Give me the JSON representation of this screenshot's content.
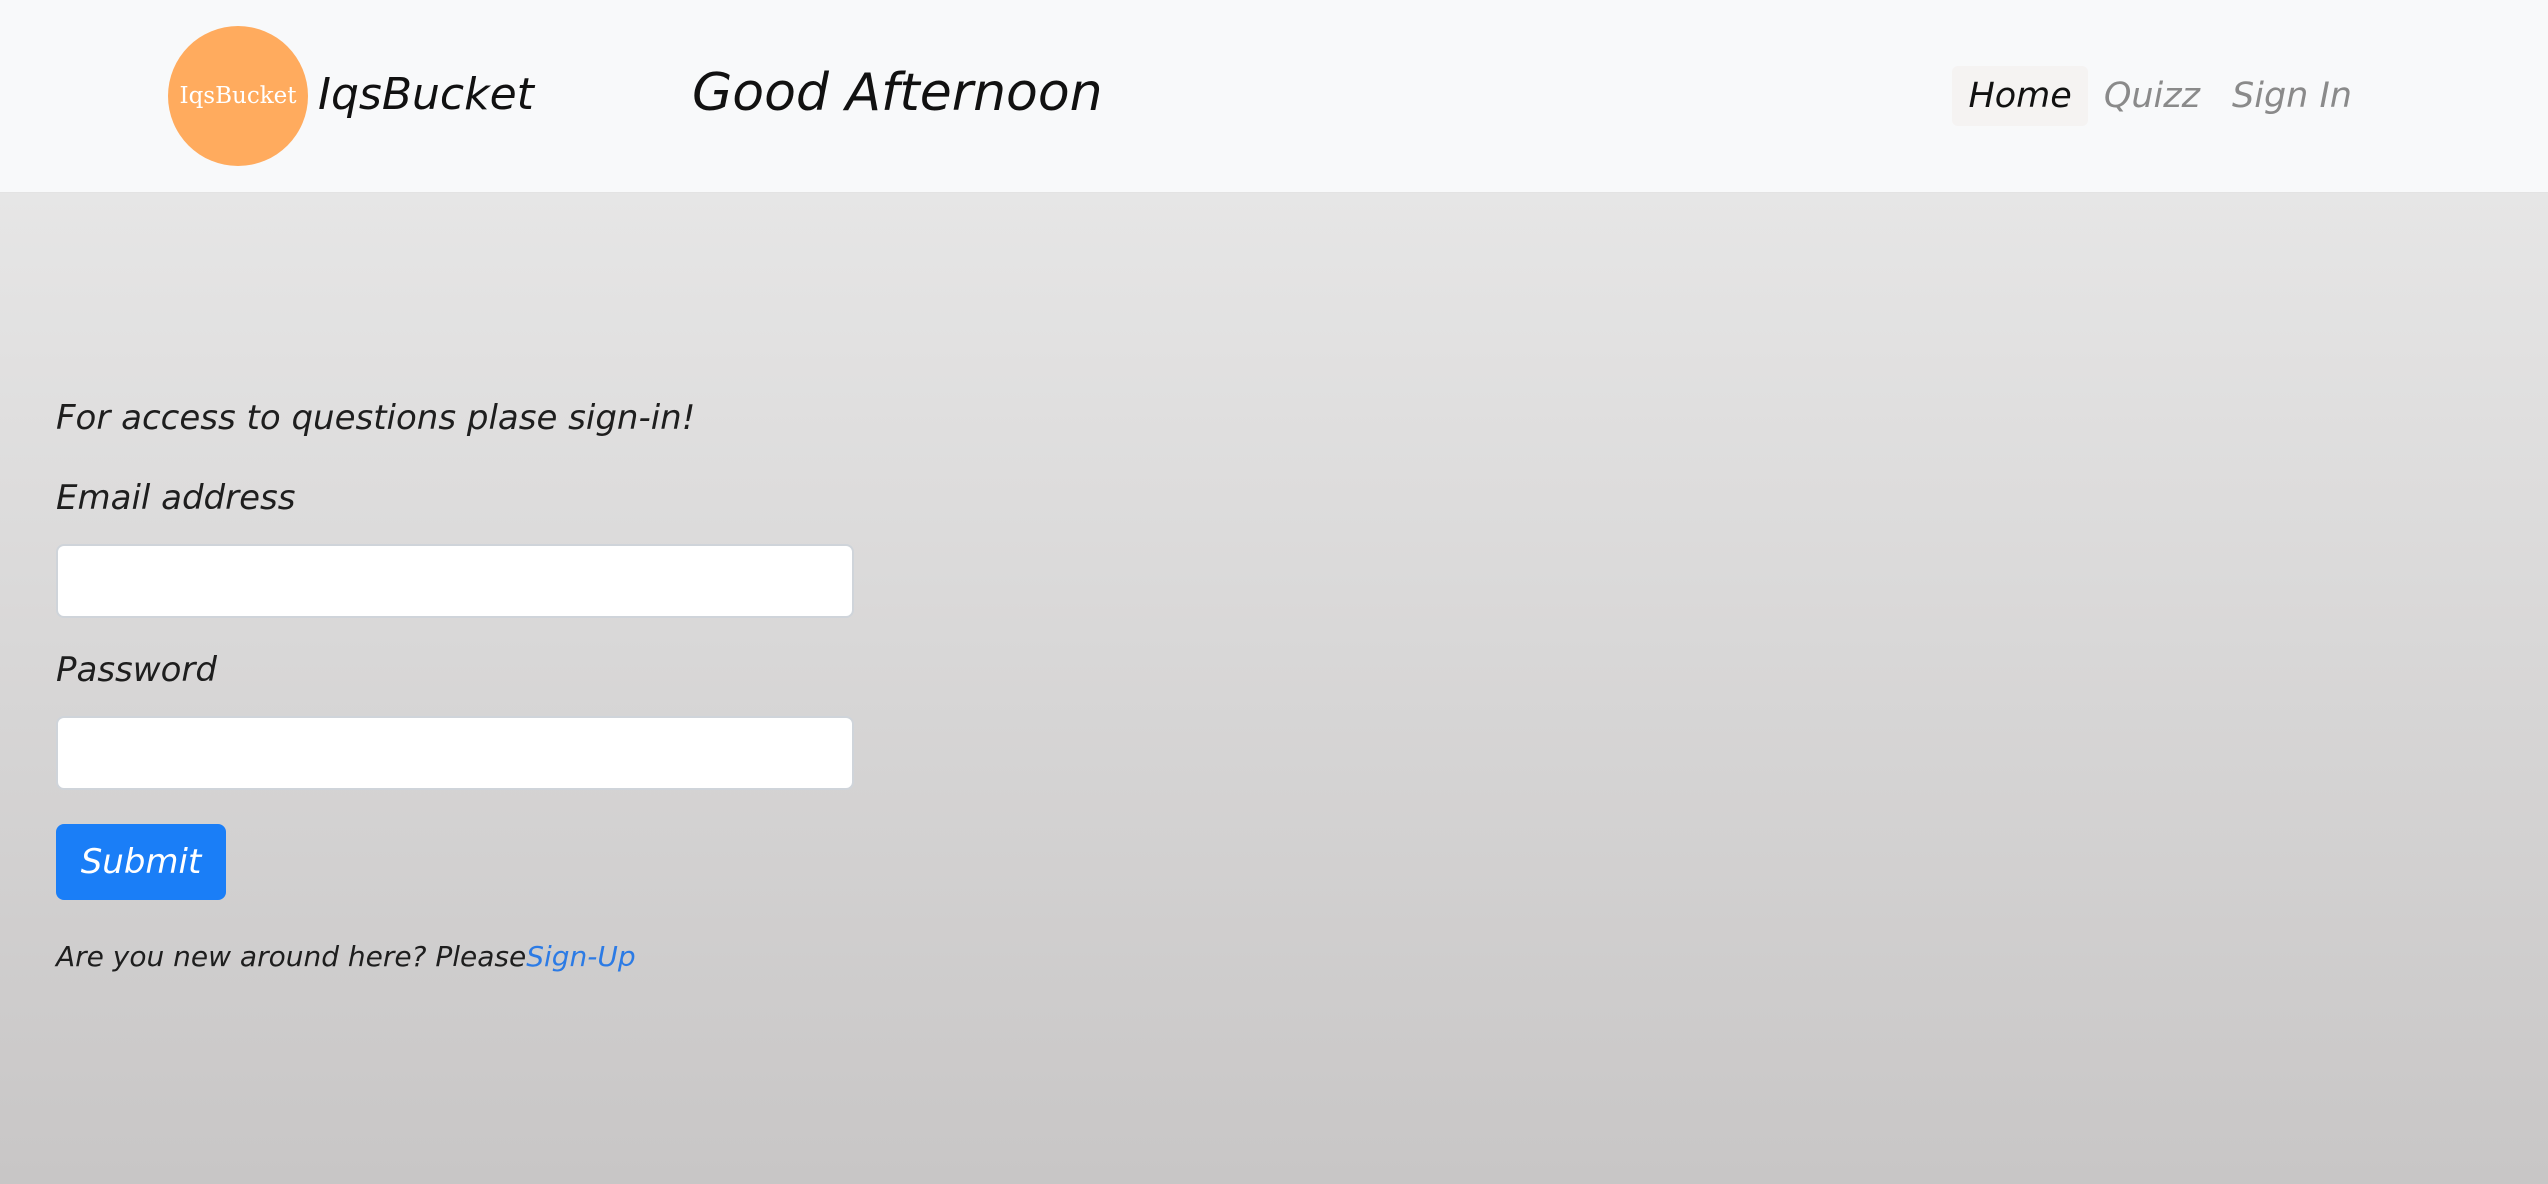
{
  "header": {
    "logo_text": "IqsBucket",
    "brand": "IqsBucket",
    "greeting": "Good Afternoon",
    "nav": [
      {
        "label": "Home",
        "active": true
      },
      {
        "label": "Quizz",
        "active": false
      },
      {
        "label": "Sign In",
        "active": false
      }
    ]
  },
  "form": {
    "intro": "For access to questions plase sign-in!",
    "email_label": "Email address",
    "email_value": "",
    "password_label": "Password",
    "password_value": "",
    "submit_label": "Submit",
    "signup_prompt": "Are you new around here? Please",
    "signup_link": "Sign-Up"
  },
  "colors": {
    "logo": "#ffab5e",
    "primary": "#1a7ef7",
    "link": "#2c7be5"
  }
}
